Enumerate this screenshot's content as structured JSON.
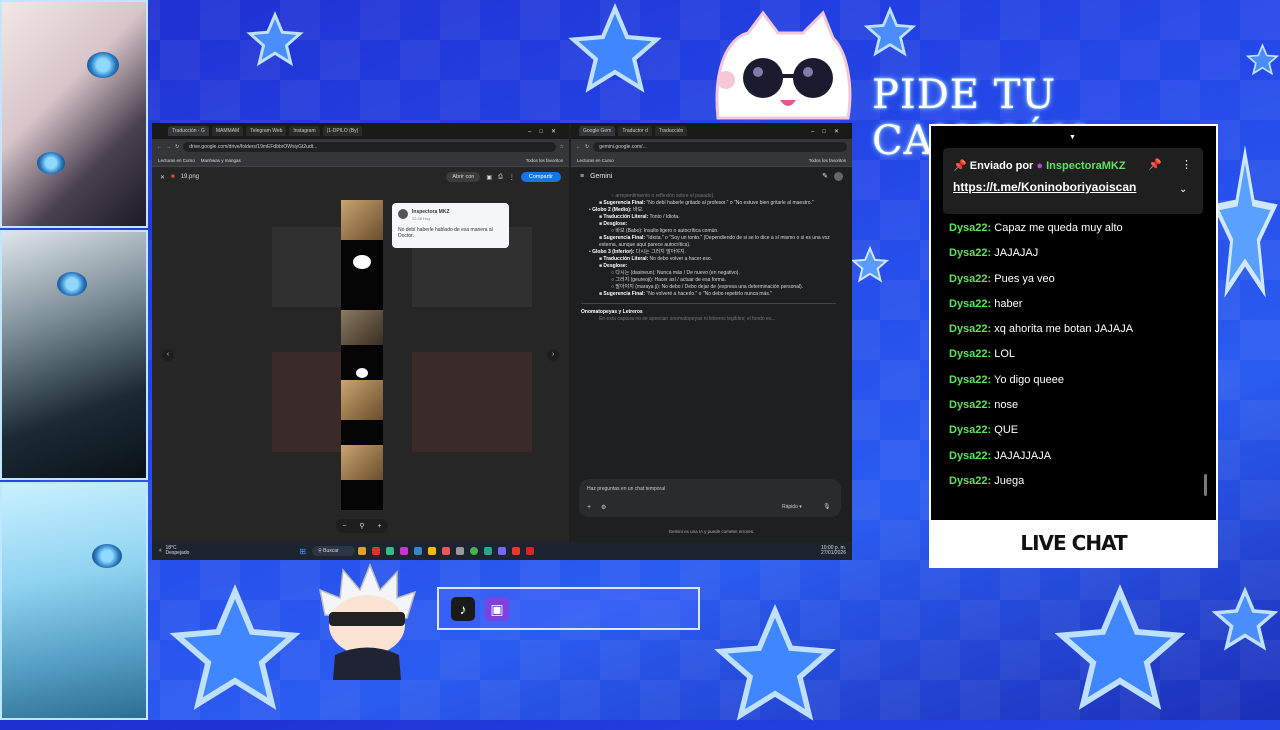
{
  "overlay": {
    "title": "PIDE TU CANCIÓN",
    "live_chat_label": "LIVE CHAT",
    "social_icons": [
      "tiktok-icon",
      "twitch-icon"
    ]
  },
  "browser_left": {
    "tabs": [
      "Traducción - G",
      "MAMMAM",
      "Telegram Web",
      "Instagram",
      "(1-DPILO (By)"
    ],
    "url": "drive.google.com/drive/folders/19mEFdbbrOWsiyGt2udt...",
    "bookmarks": [
      "Lecturas en Curso",
      "Manhwas y mangas",
      "Todos los favoritos"
    ],
    "file_name": "19.png",
    "open_with": "Abrir con",
    "share": "Compartir",
    "comment": {
      "author": "Inspectora MKZ",
      "time": "22:36 Hoy",
      "text": "No debí haberle hablado de esa manera al Doctor."
    }
  },
  "browser_right": {
    "tabs": [
      "Google Gem",
      "Traductor d",
      "Traducción"
    ],
    "url": "gemini.google.com/...",
    "bookmarks": [
      "Lecturas en Curso",
      "Todos los favoritos"
    ],
    "app_title": "Gemini",
    "content": [
      {
        "level": 2,
        "text": "arrepentimiento o reflexión sobre el pasado).",
        "fade": true
      },
      {
        "level": 1,
        "bold": "Sugerencia Final:",
        "text": " \"No debí haberle gritado al profesor.\" o \"No estuve bien gritarle al maestro.\""
      },
      {
        "level": 0,
        "bold": "Globo 2 (Medio):",
        "text": " 바보."
      },
      {
        "level": 1,
        "bold": "Traducción Literal:",
        "text": " Tonto / Idiota."
      },
      {
        "level": 1,
        "bold": "Desglose:",
        "text": ""
      },
      {
        "level": 2,
        "text": "바보 (Babo): Insulto ligero o autocrítica común."
      },
      {
        "level": 1,
        "bold": "Sugerencia Final:",
        "text": " \"Idiota.\" o \"Soy un tonto.\" (Dependiendo de si se lo dice a sí mismo o si es una voz externa, aunque aquí parece autocrítica)."
      },
      {
        "level": 0,
        "bold": "Globo 3 (Inferior):",
        "text": " 다시는 그러지 말아야지."
      },
      {
        "level": 1,
        "bold": "Traducción Literal:",
        "text": " No debo volver a hacer eso."
      },
      {
        "level": 1,
        "bold": "Desglose:",
        "text": ""
      },
      {
        "level": 2,
        "text": "다시는 (dasineun): Nunca más / De nuevo (en negativo)."
      },
      {
        "level": 2,
        "text": "그러지 (geureoji): Hacer así / actuar de esa forma."
      },
      {
        "level": 2,
        "text": "말아야지 (maraya ji): No debo / Debo dejar de (expresa una determinación personal)."
      },
      {
        "level": 1,
        "bold": "Sugerencia Final:",
        "text": " \"No volveré a hacerlo.\" o \"No debo repetirlo nunca más.\""
      }
    ],
    "section_heading": "Onomatopeyas y Letreros",
    "section_text": "En esta captura no se aprecian onomatopeyas ni letreros legibles; el fondo es...",
    "input_placeholder": "Haz preguntas en un chat temporal",
    "mode": "Rápido",
    "disclaimer": "Gemini es una IA y puede cometer errores."
  },
  "taskbar": {
    "weather_temp": "18°C",
    "weather_desc": "Despejado",
    "search": "Buscar",
    "time": "10:00 p. m.",
    "date": "27/01/2026"
  },
  "chat": {
    "pinned": {
      "prefix": "Enviado por",
      "author": "InspectoraMKZ",
      "link": "https://t.me/Koninoboriyaoiscan"
    },
    "messages": [
      {
        "user": "Dysa22:",
        "text": " Capaz me queda muy alto"
      },
      {
        "user": "Dysa22:",
        "text": " JAJAJAJ"
      },
      {
        "user": "Dysa22:",
        "text": " Pues ya veo"
      },
      {
        "user": "Dysa22:",
        "text": " haber"
      },
      {
        "user": "Dysa22:",
        "text": " xq ahorita me botan JAJAJA"
      },
      {
        "user": "Dysa22:",
        "text": " LOL"
      },
      {
        "user": "Dysa22:",
        "text": " Yo digo queee"
      },
      {
        "user": "Dysa22:",
        "text": " nose"
      },
      {
        "user": "Dysa22:",
        "text": " QUE"
      },
      {
        "user": "Dysa22:",
        "text": " JAJAJJAJA"
      },
      {
        "user": "Dysa22:",
        "text": " Juega"
      }
    ]
  },
  "colors": {
    "background": "#2447e8",
    "chat_user": "#5fe05f",
    "accent": "#1a73e8"
  }
}
